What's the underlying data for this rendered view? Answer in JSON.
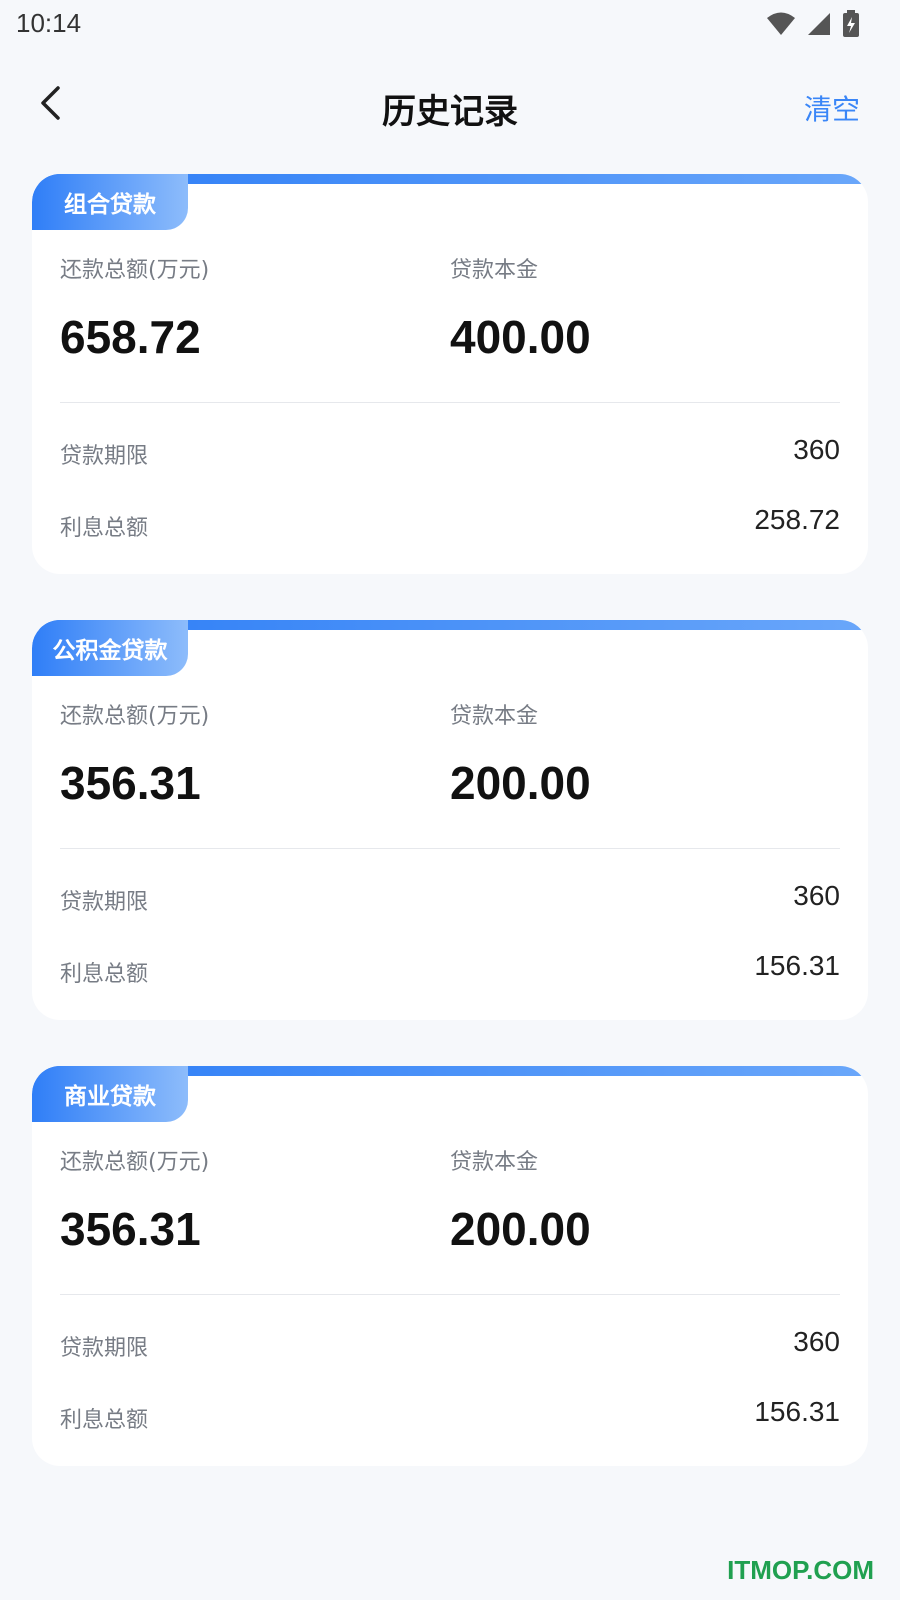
{
  "status": {
    "time": "10:14"
  },
  "header": {
    "title": "历史记录",
    "clear_label": "清空"
  },
  "labels": {
    "total_repay": "还款总额(万元)",
    "principal": "贷款本金",
    "term": "贷款期限",
    "interest_total": "利息总额"
  },
  "records": [
    {
      "type": "组合贷款",
      "total_repay": "658.72",
      "principal": "400.00",
      "term": "360",
      "interest": "258.72"
    },
    {
      "type": "公积金贷款",
      "total_repay": "356.31",
      "principal": "200.00",
      "term": "360",
      "interest": "156.31"
    },
    {
      "type": "商业贷款",
      "total_repay": "356.31",
      "principal": "200.00",
      "term": "360",
      "interest": "156.31"
    }
  ],
  "watermark": "ITMOP.COM",
  "colors": {
    "accent": "#3a86f7",
    "tag_start": "#2f7ef7",
    "tag_end": "#8dbcfb",
    "background": "#f6f8fb"
  }
}
